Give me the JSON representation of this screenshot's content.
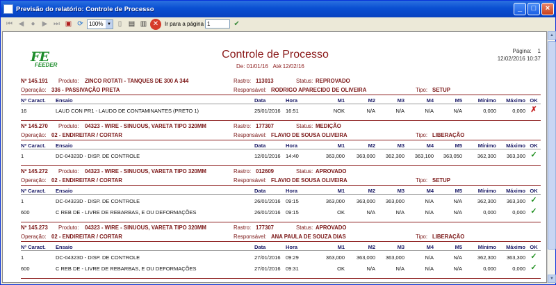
{
  "window": {
    "title": "Previsão do relatório: Controle de Processo"
  },
  "toolbar": {
    "zoom": "100%",
    "goto_label": "Ir para a página",
    "page_value": "1"
  },
  "report": {
    "title": "Controle de Processo",
    "period_from": "De: 01/01/16",
    "period_to": "Até:12/02/16",
    "page_label": "Página:",
    "page_number": "1",
    "printed_at": "12/02/2016 10:37",
    "logo_text": "FEEDER"
  },
  "labels": {
    "produto": "Produto:",
    "operacao": "Operação:",
    "rastro": "Rastro:",
    "status": "Status:",
    "responsavel": "Responsável:",
    "tipo": "Tipo:"
  },
  "columns": [
    "Nº Caract.",
    "Ensaio",
    "Data",
    "Hora",
    "M1",
    "M2",
    "M3",
    "M4",
    "M5",
    "Mínimo",
    "Máximo",
    "OK"
  ],
  "groups": [
    {
      "number": "Nº 145.191",
      "product": "ZINCO ROTATI - TANQUES DE 300 A 344",
      "operation": "336 - PASSIVAÇÃO PRETA",
      "rastro": "113013",
      "status": "REPROVADO",
      "responsavel": "RODRIGO APARECIDO DE OLIVEIRA",
      "tipo": "SETUP",
      "rows": [
        {
          "caract": "16",
          "ensaio": "LAUD CON PR1 - LAUDO DE CONTAMINANTES (PRETO 1)",
          "data": "25/01/2016",
          "hora": "16:51",
          "m1": "NOK",
          "m2": "N/A",
          "m3": "N/A",
          "m4": "N/A",
          "m5": "N/A",
          "min": "0,000",
          "max": "0,000",
          "ok": "✗",
          "ok_state": "fail"
        }
      ]
    },
    {
      "number": "Nº 145.270",
      "product": "04323 - WIRE - SINUOUS, VARETA TIPO 320MM",
      "operation": "02 - ENDIREITAR / CORTAR",
      "rastro": "177307",
      "status": "MEDIÇÃO",
      "responsavel": "FLAVIO DE SOUSA OLIVEIRA",
      "tipo": "LIBERAÇÃO",
      "rows": [
        {
          "caract": "1",
          "ensaio": "DC-04323D - DISP. DE CONTROLE",
          "data": "12/01/2016",
          "hora": "14:40",
          "m1": "363,000",
          "m2": "363,000",
          "m3": "362,300",
          "m4": "363,100",
          "m5": "363,050",
          "min": "362,300",
          "max": "363,300",
          "ok": "✓",
          "ok_state": "pass"
        }
      ]
    },
    {
      "number": "Nº 145.272",
      "product": "04323 - WIRE - SINUOUS, VARETA TIPO 320MM",
      "operation": "02 - ENDIREITAR / CORTAR",
      "rastro": "012609",
      "status": "APROVADO",
      "responsavel": "FLAVIO DE SOUSA OLIVEIRA",
      "tipo": "SETUP",
      "rows": [
        {
          "caract": "1",
          "ensaio": "DC-04323D - DISP. DE CONTROLE",
          "data": "26/01/2016",
          "hora": "09:15",
          "m1": "363,000",
          "m2": "363,000",
          "m3": "363,000",
          "m4": "N/A",
          "m5": "N/A",
          "min": "362,300",
          "max": "363,300",
          "ok": "✓",
          "ok_state": "pass"
        },
        {
          "caract": "600",
          "ensaio": "C REB DE - LIVRE DE REBARBAS, E OU DEFORMAÇÕES",
          "data": "26/01/2016",
          "hora": "09:15",
          "m1": "OK",
          "m2": "N/A",
          "m3": "N/A",
          "m4": "N/A",
          "m5": "N/A",
          "min": "0,000",
          "max": "0,000",
          "ok": "✓",
          "ok_state": "pass"
        }
      ]
    },
    {
      "number": "Nº 145.273",
      "product": "04323 - WIRE - SINUOUS, VARETA TIPO 320MM",
      "operation": "02 - ENDIREITAR / CORTAR",
      "rastro": "177307",
      "status": "APROVADO",
      "responsavel": "ANA PAULA DE SOUZA DIAS",
      "tipo": "LIBERAÇÃO",
      "rows": [
        {
          "caract": "1",
          "ensaio": "DC-04323D - DISP. DE CONTROLE",
          "data": "27/01/2016",
          "hora": "09:29",
          "m1": "363,000",
          "m2": "363,000",
          "m3": "363,000",
          "m4": "N/A",
          "m5": "N/A",
          "min": "362,300",
          "max": "363,300",
          "ok": "✓",
          "ok_state": "pass"
        },
        {
          "caract": "600",
          "ensaio": "C REB DE - LIVRE DE REBARBAS, E OU DEFORMAÇÕES",
          "data": "27/01/2016",
          "hora": "09:31",
          "m1": "OK",
          "m2": "N/A",
          "m3": "N/A",
          "m4": "N/A",
          "m5": "N/A",
          "min": "0,000",
          "max": "0,000",
          "ok": "✓",
          "ok_state": "pass"
        }
      ]
    }
  ]
}
